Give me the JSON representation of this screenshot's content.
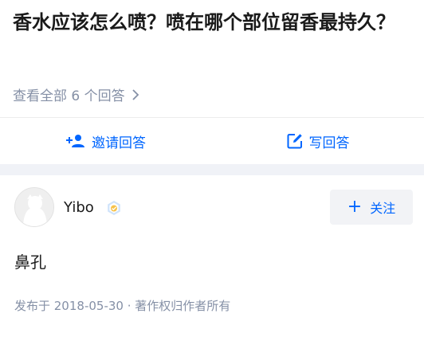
{
  "question": {
    "title": "香水应该怎么喷？喷在哪个部位留香最持久？",
    "view_all": "查看全部 6 个回答"
  },
  "actions": {
    "invite": "邀请回答",
    "write": "写回答"
  },
  "answer": {
    "author": "Yibo",
    "follow": "关注",
    "body": "鼻孔",
    "meta": "发布于 2018-05-30 · 著作权归作者所有"
  },
  "colors": {
    "accent": "#0066ff",
    "muted": "#8590a6",
    "section_gap": "#f0f2f7"
  },
  "icons": [
    "chevron-right-icon",
    "add-person-icon",
    "edit-icon",
    "verified-badge-icon",
    "default-avatar"
  ]
}
